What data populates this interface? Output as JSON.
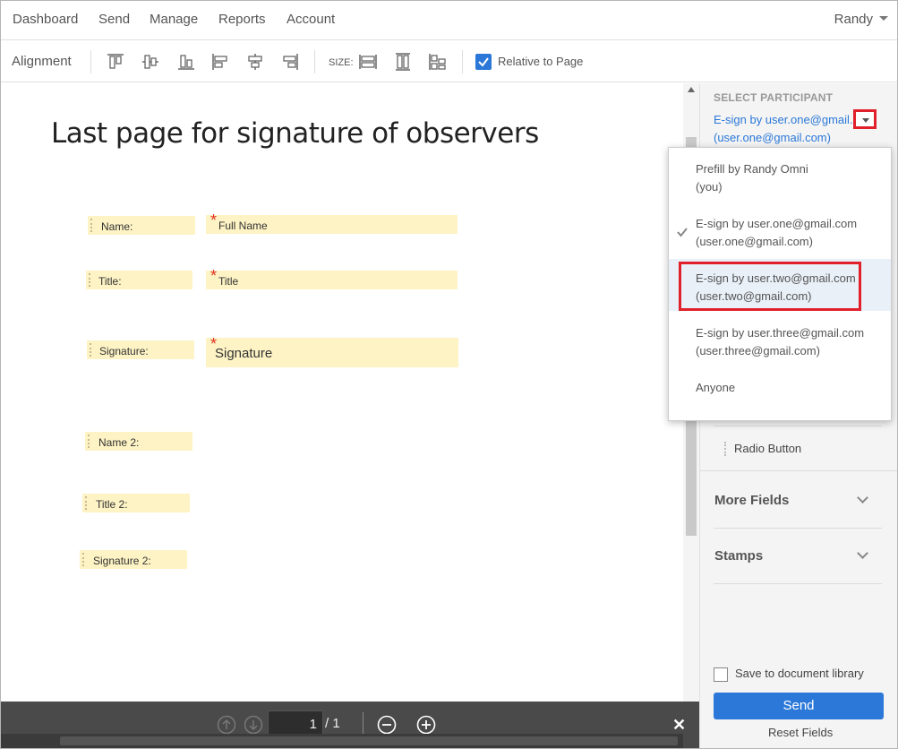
{
  "nav": {
    "items": [
      "Dashboard",
      "Send",
      "Manage",
      "Reports",
      "Account"
    ],
    "user": "Randy"
  },
  "toolbar": {
    "alignment_label": "Alignment",
    "size_label": "SIZE:",
    "relative_label": "Relative to Page",
    "relative_checked": true
  },
  "document": {
    "title": "Last page for signature of observers",
    "fields": {
      "name_label": "Name:",
      "full_name": "Full Name",
      "title_label": "Title:",
      "title_field": "Title",
      "signature_label": "Signature:",
      "signature_field": "Signature",
      "name2_label": "Name 2:",
      "title2_label": "Title 2:",
      "signature2_label": "Signature 2:"
    }
  },
  "pager": {
    "current": "1",
    "of": "/ 1"
  },
  "panel": {
    "select_participant_title": "SELECT PARTICIPANT",
    "selected_line1": "E-sign by user.one@gmail.c...",
    "selected_line2": "(user.one@gmail.com)",
    "radio_button": "Radio Button",
    "more_fields": "More Fields",
    "stamps": "Stamps",
    "save_label": "Save to document library",
    "send": "Send",
    "reset": "Reset Fields"
  },
  "menu": {
    "items": [
      {
        "line1": "Prefill by Randy Omni",
        "line2": "(you)"
      },
      {
        "line1": "E-sign by user.one@gmail.com",
        "line2": "(user.one@gmail.com)"
      },
      {
        "line1": "E-sign by user.two@gmail.com",
        "line2": "(user.two@gmail.com)"
      },
      {
        "line1": "E-sign by user.three@gmail.com",
        "line2": "(user.three@gmail.com)"
      },
      {
        "line1": "Anyone",
        "line2": ""
      }
    ],
    "checked_index": 1,
    "highlighted_index": 2
  },
  "colors": {
    "accent": "#2b78d8",
    "field_bg": "#fdf3c4",
    "highlight_border": "#e0202a"
  }
}
